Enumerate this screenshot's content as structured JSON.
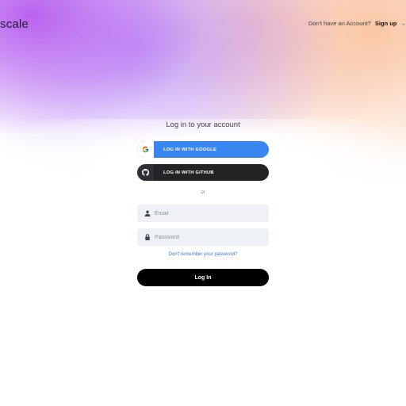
{
  "header": {
    "logo_text": "scale",
    "signup_prompt": "Don't have an Account?",
    "signup_label": "Sign up",
    "signup_arrow": "→"
  },
  "login": {
    "title": "Log in to your account",
    "google_label": "LOG IN WITH GOOGLE",
    "github_label": "LOG IN WITH GITHUB",
    "divider": "or",
    "email_placeholder": "Email",
    "email_value": "",
    "password_placeholder": "Password",
    "password_value": "",
    "forgot_label": "Don't remember your password?",
    "submit_label": "Log In"
  },
  "icons": {
    "google": "google-icon",
    "github": "github-icon",
    "email": "user-icon",
    "password": "lock-icon"
  },
  "colors": {
    "google_button": "#3a86f0",
    "github_button": "#222426",
    "login_button": "#000000",
    "link": "#3a7bd5",
    "input_bg": "#eef1f5"
  }
}
